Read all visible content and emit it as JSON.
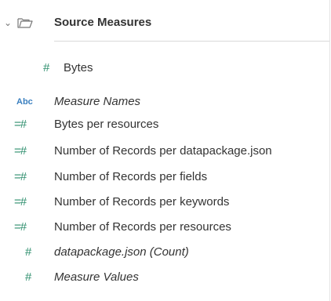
{
  "header": {
    "title": "Source Measures",
    "chevron_icon": "chevron-down-icon",
    "folder_icon": "folder-open-icon"
  },
  "colors": {
    "measure_icon": "#2f8f6e",
    "dimension_icon": "#3a7fbf",
    "text": "#333333",
    "separator": "#d9d9d9"
  },
  "fields": [
    {
      "label": "Bytes",
      "icon": "#",
      "type": "measure",
      "italic": false
    },
    {
      "label": "Measure Names",
      "icon": "Abc",
      "type": "dimension",
      "italic": true
    },
    {
      "label": "Bytes per resources",
      "icon": "=#",
      "type": "calculated-measure",
      "italic": false
    },
    {
      "label": "Number of Records per datapackage.json",
      "icon": "=#",
      "type": "calculated-measure",
      "italic": false
    },
    {
      "label": "Number of Records per fields",
      "icon": "=#",
      "type": "calculated-measure",
      "italic": false
    },
    {
      "label": "Number of Records per keywords",
      "icon": "=#",
      "type": "calculated-measure",
      "italic": false
    },
    {
      "label": "Number of Records per resources",
      "icon": "=#",
      "type": "calculated-measure",
      "italic": false
    },
    {
      "label": "datapackage.json (Count)",
      "icon": "#",
      "type": "measure",
      "italic": true
    },
    {
      "label": "Measure Values",
      "icon": "#",
      "type": "measure",
      "italic": true
    }
  ]
}
